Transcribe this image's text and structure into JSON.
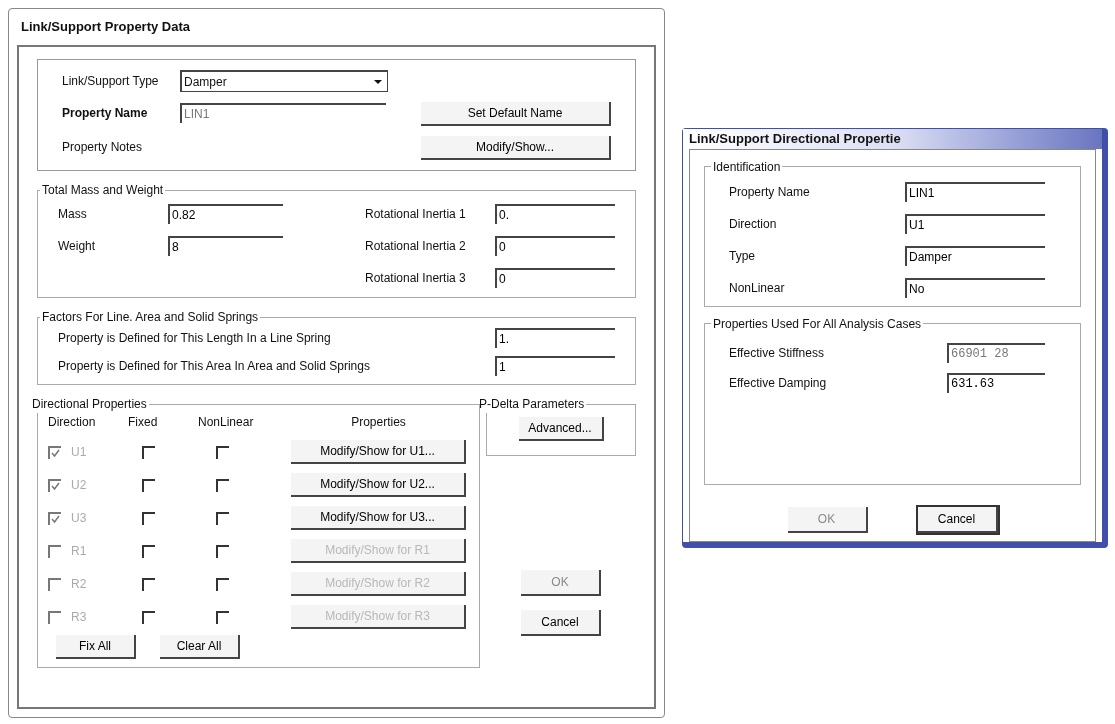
{
  "main_dialog": {
    "title": "Link/Support Property Data",
    "general": {
      "type_label": "Link/Support Type",
      "type_value": "Damper",
      "name_label": "Property Name",
      "name_value": "LIN1",
      "notes_label": "Property Notes",
      "set_default_button": "Set Default Name",
      "notes_button": "Modify/Show..."
    },
    "mass_weight": {
      "legend": "Total Mass and Weight",
      "columns": [
        [
          {
            "label": "Mass",
            "value": "0.82"
          },
          {
            "label": "Weight",
            "value": "8"
          }
        ],
        [
          {
            "label": "Rotational Inertia 1",
            "value": "0."
          },
          {
            "label": "Rotational Inertia 2",
            "value": "0"
          },
          {
            "label": "Rotational Inertia 3",
            "value": "0"
          }
        ]
      ]
    },
    "factors": {
      "legend": "Factors For Line. Area and Solid Springs",
      "fields": [
        {
          "label": "Property is Defined for This Length In a Line Spring",
          "value": "1."
        },
        {
          "label": "Property is Defined for This Area In Area and Solid Springs",
          "value": "1"
        }
      ]
    },
    "directional": {
      "legend": "Directional Properties",
      "columns": [
        "Direction",
        "Fixed",
        "NonLinear",
        "Properties"
      ],
      "rows": [
        {
          "direction": "U1",
          "checked": true,
          "fixed": false,
          "nonlinear": false,
          "button": "Modify/Show for U1...",
          "disabled": false
        },
        {
          "direction": "U2",
          "checked": true,
          "fixed": false,
          "nonlinear": false,
          "button": "Modify/Show for U2...",
          "disabled": false
        },
        {
          "direction": "U3",
          "checked": true,
          "fixed": false,
          "nonlinear": false,
          "button": "Modify/Show for U3...",
          "disabled": false
        },
        {
          "direction": "R1",
          "checked": false,
          "fixed": false,
          "nonlinear": false,
          "button": "Modify/Show for R1",
          "disabled": true
        },
        {
          "direction": "R2",
          "checked": false,
          "fixed": false,
          "nonlinear": false,
          "button": "Modify/Show for R2",
          "disabled": true
        },
        {
          "direction": "R3",
          "checked": false,
          "fixed": false,
          "nonlinear": false,
          "button": "Modify/Show for R3",
          "disabled": true
        }
      ],
      "buttons": [
        "Fix All",
        "Clear All"
      ]
    },
    "p_delta": {
      "legend": "P-Delta Parameters",
      "button": "Advanced..."
    },
    "buttons": [
      {
        "label": "OK",
        "disabled": true
      },
      {
        "label": "Cancel",
        "disabled": false
      }
    ]
  },
  "directional_dialog": {
    "title": "Link/Support Directional Propertie",
    "identification": {
      "legend": "Identification",
      "fields": [
        {
          "label": "Property Name",
          "value": "LIN1"
        },
        {
          "label": "Direction",
          "value": "U1"
        },
        {
          "label": "Type",
          "value": "Damper"
        },
        {
          "label": "NonLinear",
          "value": "No"
        }
      ]
    },
    "analysis": {
      "legend": "Properties Used For All Analysis Cases",
      "fields": [
        {
          "label": "Effective Stiffness",
          "value": "66901 28",
          "disabled": true
        },
        {
          "label": "Effective Damping",
          "value": "631.63",
          "disabled": false
        }
      ]
    },
    "buttons": [
      {
        "label": "OK",
        "disabled": true
      },
      {
        "label": "Cancel",
        "disabled": false
      }
    ]
  }
}
